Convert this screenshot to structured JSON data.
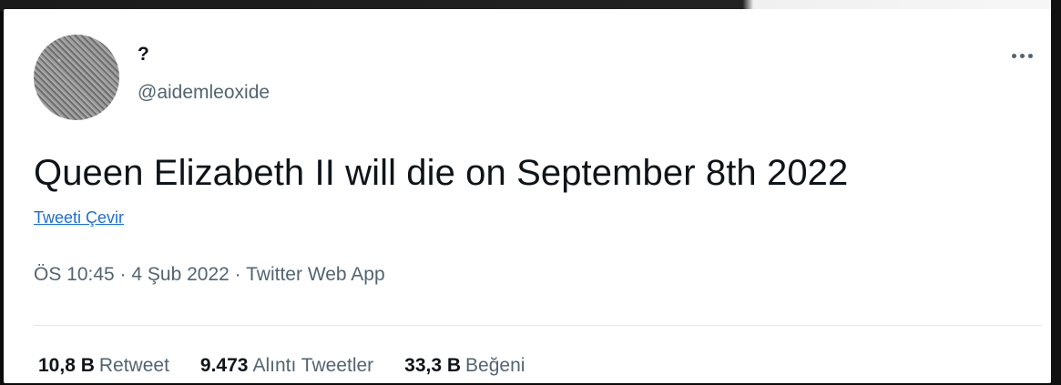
{
  "tweet": {
    "display_name": "?",
    "handle": "@aidemleoxide",
    "text": "Queen Elizabeth II will die on September 8th 2022",
    "translate_label": "Tweeti Çevir",
    "meta": {
      "time": "ÖS 10:45",
      "separator": " · ",
      "date": "4 Şub 2022",
      "source": "Twitter Web App"
    },
    "stats": [
      {
        "value": "10,8 B",
        "label": "Retweet"
      },
      {
        "value": "9.473",
        "label": "Alıntı Tweetler"
      },
      {
        "value": "33,3 B",
        "label": "Beğeni"
      }
    ],
    "more_icon": "more-horizontal-icon"
  },
  "colors": {
    "primary_text": "#0f1419",
    "secondary_text": "#536471",
    "link": "#1d6fd6",
    "divider": "#e1e8ed"
  }
}
